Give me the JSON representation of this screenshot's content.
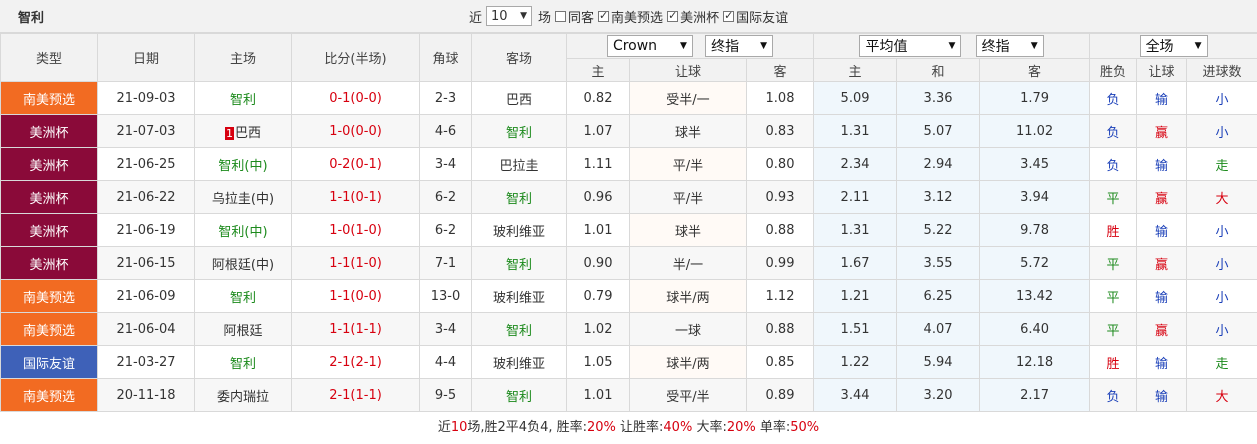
{
  "team": "智利",
  "filters": {
    "prefix": "近",
    "count": "10",
    "suffix": "场",
    "options": [
      {
        "label": "同客",
        "checked": false
      },
      {
        "label": "南美预选",
        "checked": true
      },
      {
        "label": "美洲杯",
        "checked": true
      },
      {
        "label": "国际友谊",
        "checked": true
      }
    ]
  },
  "header": {
    "type": "类型",
    "date": "日期",
    "home": "主场",
    "score": "比分(半场)",
    "corner": "角球",
    "away": "客场",
    "company": "Crown",
    "odds_mode1": "终指",
    "avg": "平均值",
    "odds_mode2": "终指",
    "scope": "全场",
    "sub": {
      "h1": "主",
      "handicap": "让球",
      "a1": "客",
      "h2": "主",
      "d2": "和",
      "a2": "客",
      "wl": "胜负",
      "hc": "让球",
      "goals": "进球数"
    }
  },
  "colors": {
    "南美预选": "#f26b22",
    "美洲杯": "#8a0a39",
    "国际友谊": "#3e61b8"
  },
  "rows": [
    {
      "type": "南美预选",
      "date": "21-09-03",
      "home": "智利",
      "home_green": true,
      "score": "0-1",
      "half": "(0-0)",
      "corner": "2-3",
      "away": "巴西",
      "away_green": false,
      "o1": "0.82",
      "hcp": "受半/一",
      "o2": "1.08",
      "e1": "5.09",
      "e2": "3.36",
      "e3": "1.79",
      "wl": "负",
      "hc": "输",
      "goals": "小"
    },
    {
      "type": "美洲杯",
      "date": "21-07-03",
      "home_badge": "1",
      "home": "巴西",
      "home_green": false,
      "score": "1-0",
      "half": "(0-0)",
      "corner": "4-6",
      "away": "智利",
      "away_green": true,
      "o1": "1.07",
      "hcp": "球半",
      "o2": "0.83",
      "e1": "1.31",
      "e2": "5.07",
      "e3": "11.02",
      "wl": "负",
      "hc": "赢",
      "goals": "小"
    },
    {
      "type": "美洲杯",
      "date": "21-06-25",
      "home": "智利(中)",
      "home_green": true,
      "score": "0-2",
      "half": "(0-1)",
      "corner": "3-4",
      "away": "巴拉圭",
      "away_green": false,
      "o1": "1.11",
      "hcp": "平/半",
      "o2": "0.80",
      "e1": "2.34",
      "e2": "2.94",
      "e3": "3.45",
      "wl": "负",
      "hc": "输",
      "goals": "走"
    },
    {
      "type": "美洲杯",
      "date": "21-06-22",
      "home": "乌拉圭(中)",
      "home_green": false,
      "score": "1-1",
      "half": "(0-1)",
      "corner": "6-2",
      "away": "智利",
      "away_green": true,
      "o1": "0.96",
      "hcp": "平/半",
      "o2": "0.93",
      "e1": "2.11",
      "e2": "3.12",
      "e3": "3.94",
      "wl": "平",
      "hc": "赢",
      "goals": "大"
    },
    {
      "type": "美洲杯",
      "date": "21-06-19",
      "home": "智利(中)",
      "home_green": true,
      "score": "1-0",
      "half": "(1-0)",
      "corner": "6-2",
      "away": "玻利维亚",
      "away_green": false,
      "o1": "1.01",
      "hcp": "球半",
      "o2": "0.88",
      "e1": "1.31",
      "e2": "5.22",
      "e3": "9.78",
      "wl": "胜",
      "hc": "输",
      "goals": "小"
    },
    {
      "type": "美洲杯",
      "date": "21-06-15",
      "home": "阿根廷(中)",
      "home_green": false,
      "score": "1-1",
      "half": "(1-0)",
      "corner": "7-1",
      "away": "智利",
      "away_green": true,
      "o1": "0.90",
      "hcp": "半/一",
      "o2": "0.99",
      "e1": "1.67",
      "e2": "3.55",
      "e3": "5.72",
      "wl": "平",
      "hc": "赢",
      "goals": "小"
    },
    {
      "type": "南美预选",
      "date": "21-06-09",
      "home": "智利",
      "home_green": true,
      "score": "1-1",
      "half": "(0-0)",
      "corner": "13-0",
      "away": "玻利维亚",
      "away_green": false,
      "o1": "0.79",
      "hcp": "球半/两",
      "o2": "1.12",
      "e1": "1.21",
      "e2": "6.25",
      "e3": "13.42",
      "wl": "平",
      "hc": "输",
      "goals": "小"
    },
    {
      "type": "南美预选",
      "date": "21-06-04",
      "home": "阿根廷",
      "home_green": false,
      "score": "1-1",
      "half": "(1-1)",
      "corner": "3-4",
      "away": "智利",
      "away_green": true,
      "o1": "1.02",
      "hcp": "一球",
      "o2": "0.88",
      "e1": "1.51",
      "e2": "4.07",
      "e3": "6.40",
      "wl": "平",
      "hc": "赢",
      "goals": "小"
    },
    {
      "type": "国际友谊",
      "date": "21-03-27",
      "home": "智利",
      "home_green": true,
      "score": "2-1",
      "half": "(2-1)",
      "corner": "4-4",
      "away": "玻利维亚",
      "away_green": false,
      "o1": "1.05",
      "hcp": "球半/两",
      "o2": "0.85",
      "e1": "1.22",
      "e2": "5.94",
      "e3": "12.18",
      "wl": "胜",
      "hc": "输",
      "goals": "走"
    },
    {
      "type": "南美预选",
      "date": "20-11-18",
      "home": "委内瑞拉",
      "home_green": false,
      "score": "2-1",
      "half": "(1-1)",
      "corner": "9-5",
      "away": "智利",
      "away_green": true,
      "o1": "1.01",
      "hcp": "受平/半",
      "o2": "0.89",
      "e1": "3.44",
      "e2": "3.20",
      "e3": "2.17",
      "wl": "负",
      "hc": "输",
      "goals": "大"
    }
  ],
  "summary": {
    "p1": "近",
    "n": "10",
    "p2": "场,胜2平4负4, 胜率:",
    "win_rate": "20%",
    "p3": " 让胜率:",
    "hc_rate": "40%",
    "p4": " 大率:",
    "big_rate": "20%",
    "p5": " 单率:",
    "odd_rate": "50%"
  }
}
